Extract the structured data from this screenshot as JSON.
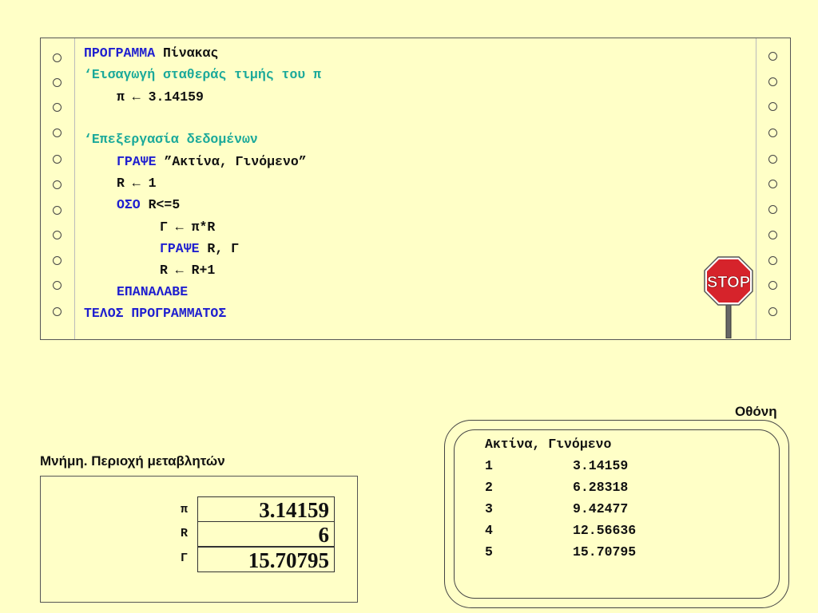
{
  "program": {
    "lines": [
      {
        "kw": "ΠΡΟΓΡΑΜΜΑ",
        "text": " Πίνακας",
        "comment": ""
      },
      {
        "kw": "",
        "text": "",
        "comment": "‘Εισαγωγή σταθεράς τιμής του π"
      },
      {
        "kw": "",
        "text": "π ← 3.14159",
        "comment": ""
      },
      {
        "kw": "",
        "text": "",
        "comment": "‘Επεξεργασία δεδομένων"
      },
      {
        "kw": "ΓΡΑΨΕ",
        "text": " ”Ακτίνα, Γινόμενο”",
        "comment": ""
      },
      {
        "kw": "",
        "text": "R ← 1",
        "comment": ""
      },
      {
        "kw": "ΟΣΟ",
        "text": " R<=5",
        "comment": ""
      },
      {
        "kw": "",
        "text": "Γ ← π*R",
        "comment": ""
      },
      {
        "kw": "ΓΡΑΨΕ",
        "text": " R, Γ",
        "comment": ""
      },
      {
        "kw": "",
        "text": "R ← R+1",
        "comment": ""
      },
      {
        "kw": "ΕΠΑΝΑΛΑΒΕ",
        "text": "",
        "comment": ""
      },
      {
        "kw": "ΤΕΛΟΣ ΠΡΟΓΡΑΜΜΑΤΟΣ",
        "text": "",
        "comment": ""
      }
    ]
  },
  "stop_sign": {
    "text": "STOP"
  },
  "memory": {
    "title": "Μνήμη. Περιοχή μεταβλητών",
    "vars": [
      {
        "name": "π",
        "value": "3.14159"
      },
      {
        "name": "R",
        "value": "6"
      },
      {
        "name": "Γ",
        "value": "15.70795"
      }
    ]
  },
  "screen": {
    "title": "Οθόνη",
    "header": "Ακτίνα, Γινόμενο",
    "rows": [
      {
        "r": "1",
        "g": "3.14159"
      },
      {
        "r": "2",
        "g": "6.28318"
      },
      {
        "r": "3",
        "g": "9.42477"
      },
      {
        "r": "4",
        "g": "12.56636"
      },
      {
        "r": "5",
        "g": "15.70795"
      }
    ]
  },
  "colors": {
    "background": "#ffffc7",
    "keyword": "#1f1fcf",
    "comment": "#1aa99a",
    "stop": "#d6232b"
  }
}
